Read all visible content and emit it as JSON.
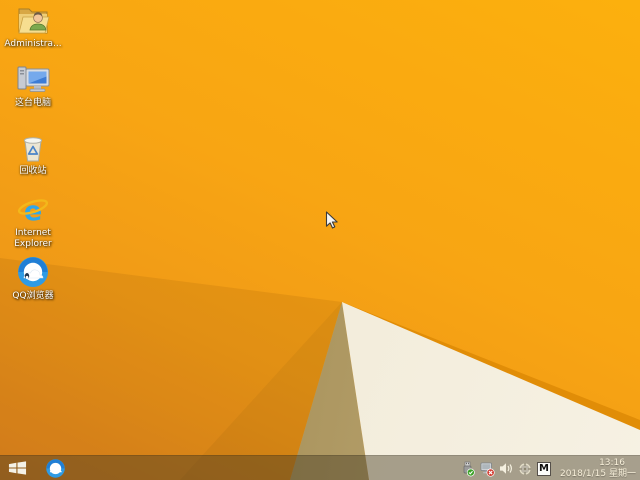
{
  "desktop": {
    "icons": [
      {
        "label": "Administra..."
      },
      {
        "label": "这台电脑"
      },
      {
        "label": "回收站"
      },
      {
        "label_line1": "Internet",
        "label_line2": "Explorer"
      },
      {
        "label": "QQ浏览器"
      }
    ]
  },
  "taskbar": {
    "tray": {
      "ime_label": "M",
      "time": "13:16",
      "date": "2018/1/15 星期一"
    }
  },
  "colors": {
    "wallpaper_orange": "#F8A513",
    "wallpaper_cream": "#F3EDDC",
    "wallpaper_tan": "#A9935C",
    "ridge_orange": "#E18D07",
    "taskbar_tint": "rgba(72,60,36,0.45)",
    "qq_blue": "#1E90E0",
    "ie_blue": "#2FA7E8",
    "check_green": "#3BA226",
    "error_red": "#D23A2E"
  }
}
